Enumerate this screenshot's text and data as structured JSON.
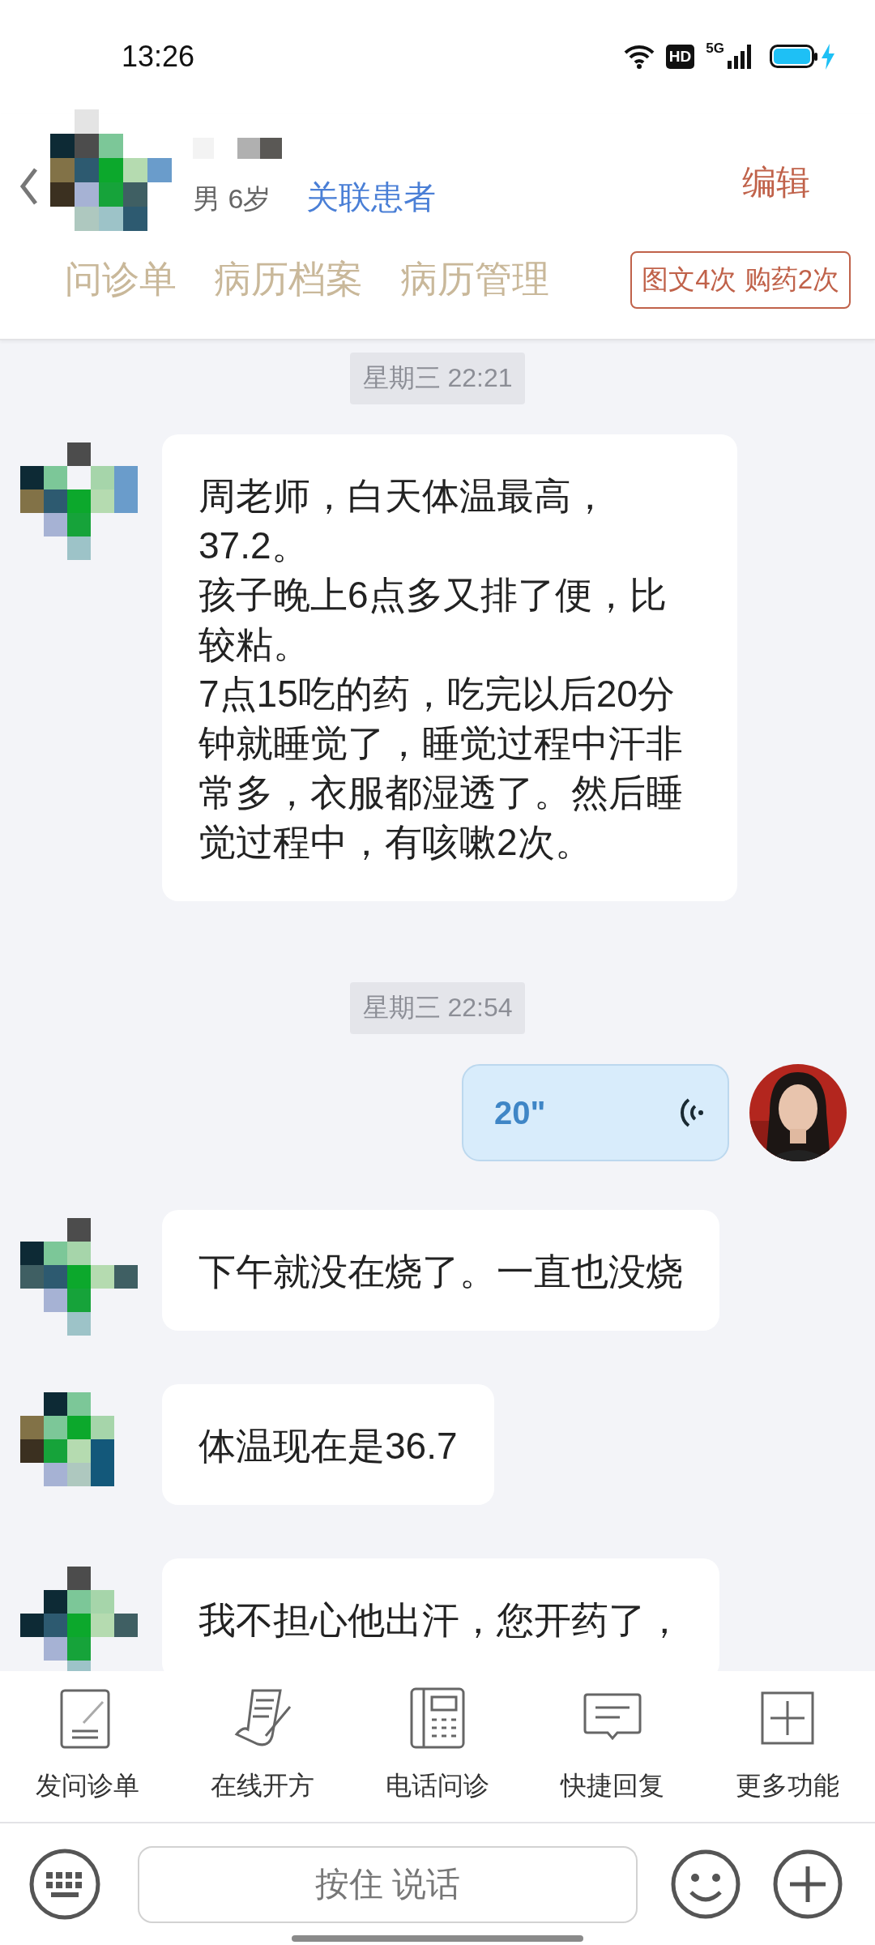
{
  "status_bar": {
    "time": "13:26",
    "hd": "HD",
    "network": "5G"
  },
  "header": {
    "gender_age": "男 6岁",
    "link": "关联患者",
    "edit": "编辑"
  },
  "tabs": [
    {
      "label": "问诊单",
      "selected": false
    },
    {
      "label": "病历档案",
      "selected": false
    },
    {
      "label": "病历管理",
      "selected": false
    }
  ],
  "badge": "图文4次 购药2次",
  "messages": [
    {
      "kind": "timestamp",
      "text": "星期三 22:21"
    },
    {
      "kind": "text",
      "outgoing": false,
      "lines": [
        "周老师，白天体温最高，37.2。",
        "孩子晚上6点多又排了便，比较粘。",
        "7点15吃的药，吃完以后20分钟就睡觉了，睡觉过程中汗非常多，衣服都湿透了。然后睡觉过程中，有咳嗽2次。"
      ]
    },
    {
      "kind": "timestamp",
      "text": "星期三 22:54"
    },
    {
      "kind": "voice",
      "outgoing": true,
      "duration": "20\""
    },
    {
      "kind": "text",
      "outgoing": false,
      "lines": [
        "下午就没在烧了。一直也没烧"
      ]
    },
    {
      "kind": "text",
      "outgoing": false,
      "lines": [
        "体温现在是36.7"
      ]
    },
    {
      "kind": "text",
      "outgoing": false,
      "lines": [
        "我不担心他出汗，您开药了，"
      ]
    }
  ],
  "tools": [
    {
      "kind": "form",
      "label": "发问诊单"
    },
    {
      "kind": "prescription",
      "label": "在线开方"
    },
    {
      "kind": "phone",
      "label": "电话问诊"
    },
    {
      "kind": "reply",
      "label": "快捷回复"
    },
    {
      "kind": "more",
      "label": "更多功能"
    }
  ],
  "input": {
    "hold_to_talk": "按住 说话"
  }
}
